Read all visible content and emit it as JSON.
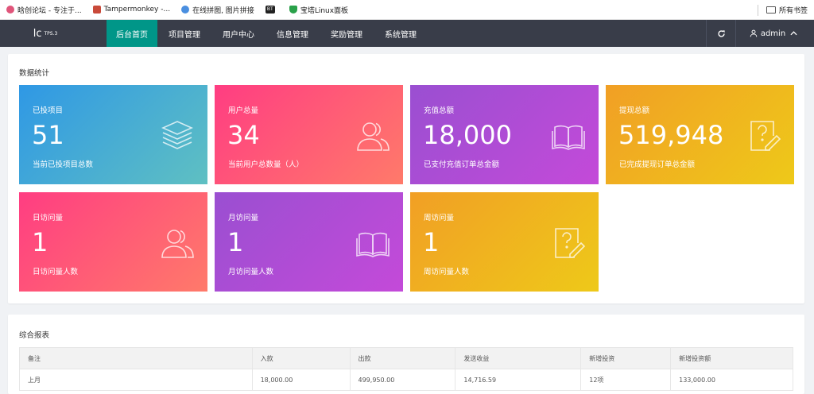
{
  "bookmarks": [
    {
      "label": "晗创论坛 - 专注于...",
      "icon": "forum-icon",
      "color": "#e0557a"
    },
    {
      "label": "Tampermonkey -...",
      "icon": "tampermonkey-icon",
      "color": "#c94a3a"
    },
    {
      "label": "在线拼图, 图片拼接",
      "icon": "cloud-icon",
      "color": "#4a8fe0"
    },
    {
      "label": "BT",
      "icon": "bt-icon",
      "color": "#222222"
    },
    {
      "label": "宝塔Linux面板",
      "icon": "shield-icon",
      "color": "#2aa14a"
    }
  ],
  "bookmarks_right": {
    "label": "所有书签",
    "icon": "folder-icon"
  },
  "nav": {
    "logo": "lc",
    "logo_sup": "TPS.3",
    "items": [
      "后台首页",
      "项目管理",
      "用户中心",
      "信息管理",
      "奖励管理",
      "系统管理"
    ],
    "active_index": 0,
    "user": "admin",
    "refresh_icon": "refresh-icon",
    "user_icon": "user-icon"
  },
  "stats": {
    "title": "数据统计",
    "cards": [
      {
        "title": "已投项目",
        "value": "51",
        "desc": "当前已投项目总数",
        "icon": "layers-icon",
        "gradient": "blue"
      },
      {
        "title": "用户总量",
        "value": "34",
        "desc": "当前用户总数量（人）",
        "icon": "users-icon",
        "gradient": "pink"
      },
      {
        "title": "充值总额",
        "value": "18,000",
        "desc": "已支付充值订单总金额",
        "icon": "book-icon",
        "gradient": "purple"
      },
      {
        "title": "提现总额",
        "value": "519,948",
        "desc": "已完成提现订单总金额",
        "icon": "question-doc-icon",
        "gradient": "orange"
      },
      {
        "title": "日访问量",
        "value": "1",
        "desc": "日访问量人数",
        "icon": "users-icon",
        "gradient": "pink"
      },
      {
        "title": "月访问量",
        "value": "1",
        "desc": "月访问量人数",
        "icon": "book-icon",
        "gradient": "purple"
      },
      {
        "title": "周访问量",
        "value": "1",
        "desc": "周访问量人数",
        "icon": "question-doc-icon",
        "gradient": "orange"
      }
    ]
  },
  "report": {
    "title": "综合报表",
    "columns": [
      "备注",
      "入款",
      "出款",
      "发送收益",
      "新增投资",
      "新增投资额"
    ],
    "rows": [
      [
        "上月",
        "18,000.00",
        "499,950.00",
        "14,716.59",
        "12项",
        "133,000.00"
      ]
    ]
  }
}
